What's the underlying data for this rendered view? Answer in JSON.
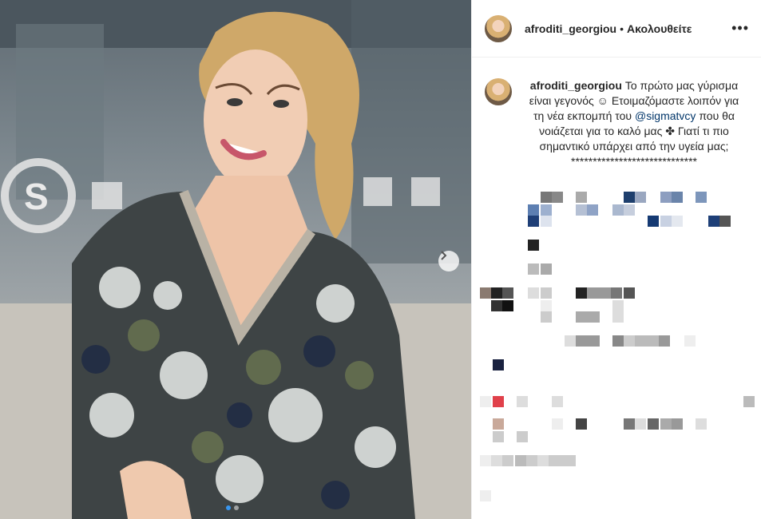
{
  "post": {
    "username": "afroditi_georgiou",
    "separator": "•",
    "follow_label": "Ακολουθείτε",
    "more_label": "•••"
  },
  "caption": {
    "username": "afroditi_georgiou",
    "text_1": "Το πρώτο μας γύρισμα είναι γεγονός ☺ Ετοιμαζόμαστε λοιπόν για τη νέα εκπομπή του",
    "mention": "@sigmatvcy",
    "text_2": "που θα νοιάζεται για το καλό μας ✤ Γιατί τι πιο σημαντικό υπάρχει από την υγεία μας; *****************************"
  },
  "carousel": {
    "next_icon": "chevron-right-icon",
    "total_slides": 2,
    "active_slide": 1
  },
  "colors": {
    "link": "#003569",
    "accent": "#3897f0"
  }
}
